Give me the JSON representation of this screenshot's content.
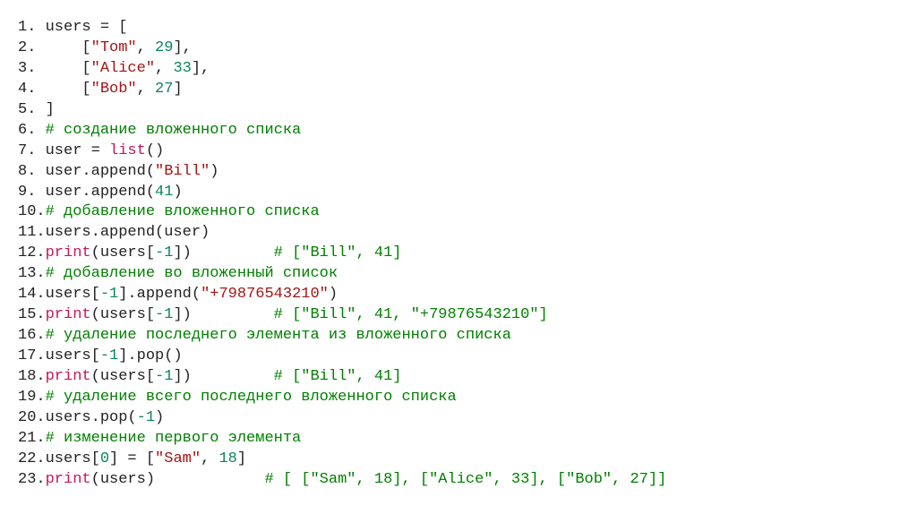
{
  "lines": [
    {
      "n": "1.",
      "segs": [
        {
          "c": "ln",
          "t": " users = ["
        }
      ]
    },
    {
      "n": "2.",
      "segs": [
        {
          "c": "ln",
          "t": "     ["
        },
        {
          "c": "str",
          "t": "\"Tom\""
        },
        {
          "c": "ln",
          "t": ", "
        },
        {
          "c": "num",
          "t": "29"
        },
        {
          "c": "ln",
          "t": "],"
        }
      ]
    },
    {
      "n": "3.",
      "segs": [
        {
          "c": "ln",
          "t": "     ["
        },
        {
          "c": "str",
          "t": "\"Alice\""
        },
        {
          "c": "ln",
          "t": ", "
        },
        {
          "c": "num",
          "t": "33"
        },
        {
          "c": "ln",
          "t": "],"
        }
      ]
    },
    {
      "n": "4.",
      "segs": [
        {
          "c": "ln",
          "t": "     ["
        },
        {
          "c": "str",
          "t": "\"Bob\""
        },
        {
          "c": "ln",
          "t": ", "
        },
        {
          "c": "num",
          "t": "27"
        },
        {
          "c": "ln",
          "t": "]"
        }
      ]
    },
    {
      "n": "5.",
      "segs": [
        {
          "c": "ln",
          "t": " ]"
        }
      ]
    },
    {
      "n": "6.",
      "segs": [
        {
          "c": "ln",
          "t": " "
        },
        {
          "c": "cmt",
          "t": "# создание вложенного списка"
        }
      ]
    },
    {
      "n": "7.",
      "segs": [
        {
          "c": "ln",
          "t": " user = "
        },
        {
          "c": "fn",
          "t": "list"
        },
        {
          "c": "ln",
          "t": "()"
        }
      ]
    },
    {
      "n": "8.",
      "segs": [
        {
          "c": "ln",
          "t": " user.append("
        },
        {
          "c": "str",
          "t": "\"Bill\""
        },
        {
          "c": "ln",
          "t": ")"
        }
      ]
    },
    {
      "n": "9.",
      "segs": [
        {
          "c": "ln",
          "t": " user.append("
        },
        {
          "c": "num",
          "t": "41"
        },
        {
          "c": "ln",
          "t": ")"
        }
      ]
    },
    {
      "n": "10.",
      "segs": [
        {
          "c": "cmt",
          "t": "# добавление вложенного списка"
        }
      ]
    },
    {
      "n": "11.",
      "segs": [
        {
          "c": "ln",
          "t": "users.append(user)"
        }
      ]
    },
    {
      "n": "12.",
      "segs": [
        {
          "c": "fn",
          "t": "print"
        },
        {
          "c": "ln",
          "t": "(users["
        },
        {
          "c": "idx",
          "t": "-1"
        },
        {
          "c": "ln",
          "t": "])         "
        },
        {
          "c": "cmt",
          "t": "# [\"Bill\", 41]"
        }
      ]
    },
    {
      "n": "13.",
      "segs": [
        {
          "c": "cmt",
          "t": "# добавление во вложенный список"
        }
      ]
    },
    {
      "n": "14.",
      "segs": [
        {
          "c": "ln",
          "t": "users["
        },
        {
          "c": "idx",
          "t": "-1"
        },
        {
          "c": "ln",
          "t": "].append("
        },
        {
          "c": "str",
          "t": "\"+79876543210\""
        },
        {
          "c": "ln",
          "t": ")"
        }
      ]
    },
    {
      "n": "15.",
      "segs": [
        {
          "c": "fn",
          "t": "print"
        },
        {
          "c": "ln",
          "t": "(users["
        },
        {
          "c": "idx",
          "t": "-1"
        },
        {
          "c": "ln",
          "t": "])         "
        },
        {
          "c": "cmt",
          "t": "# [\"Bill\", 41, \"+79876543210\"]"
        }
      ]
    },
    {
      "n": "16.",
      "segs": [
        {
          "c": "cmt",
          "t": "# удаление последнего элемента из вложенного списка"
        }
      ]
    },
    {
      "n": "17.",
      "segs": [
        {
          "c": "ln",
          "t": "users["
        },
        {
          "c": "idx",
          "t": "-1"
        },
        {
          "c": "ln",
          "t": "].pop()"
        }
      ]
    },
    {
      "n": "18.",
      "segs": [
        {
          "c": "fn",
          "t": "print"
        },
        {
          "c": "ln",
          "t": "(users["
        },
        {
          "c": "idx",
          "t": "-1"
        },
        {
          "c": "ln",
          "t": "])         "
        },
        {
          "c": "cmt",
          "t": "# [\"Bill\", 41]"
        }
      ]
    },
    {
      "n": "19.",
      "segs": [
        {
          "c": "cmt",
          "t": "# удаление всего последнего вложенного списка"
        }
      ]
    },
    {
      "n": "20.",
      "segs": [
        {
          "c": "ln",
          "t": "users.pop("
        },
        {
          "c": "idx",
          "t": "-1"
        },
        {
          "c": "ln",
          "t": ")"
        }
      ]
    },
    {
      "n": "21.",
      "segs": [
        {
          "c": "cmt",
          "t": "# изменение первого элемента"
        }
      ]
    },
    {
      "n": "22.",
      "segs": [
        {
          "c": "ln",
          "t": "users["
        },
        {
          "c": "num",
          "t": "0"
        },
        {
          "c": "ln",
          "t": "] = ["
        },
        {
          "c": "str",
          "t": "\"Sam\""
        },
        {
          "c": "ln",
          "t": ", "
        },
        {
          "c": "num",
          "t": "18"
        },
        {
          "c": "ln",
          "t": "]"
        }
      ]
    },
    {
      "n": "23.",
      "segs": [
        {
          "c": "fn",
          "t": "print"
        },
        {
          "c": "ln",
          "t": "(users)            "
        },
        {
          "c": "cmt",
          "t": "# [ [\"Sam\", 18], [\"Alice\", 33], [\"Bob\", 27]]"
        }
      ]
    }
  ]
}
